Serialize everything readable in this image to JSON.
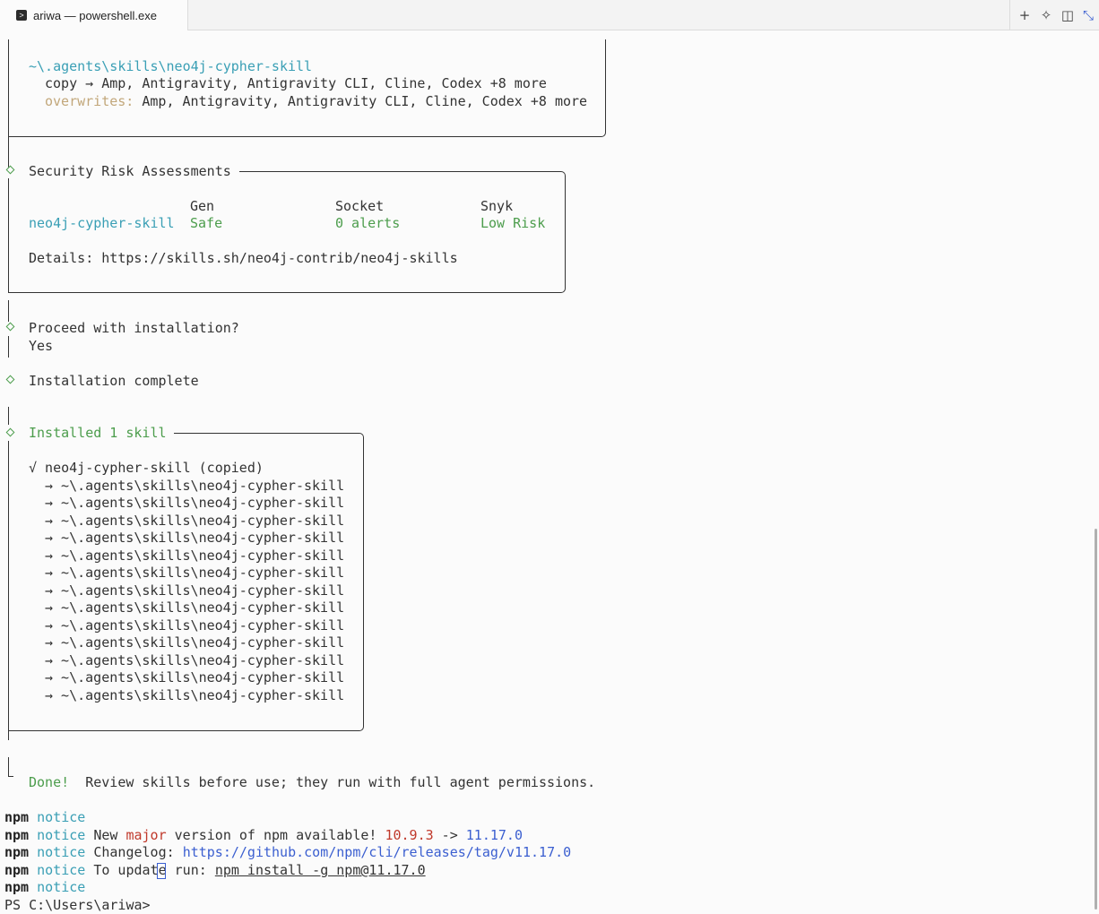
{
  "window": {
    "tab_title": "ariwa — powershell.exe",
    "tab_icon": "powershell-icon",
    "buttons": {
      "new_tab": "+",
      "magic": "✧",
      "split": "◫",
      "collapse": "⤡"
    }
  },
  "terminal": {
    "paths": {
      "path": "~\\.agents\\skills\\neo4j-cypher-skill",
      "copy_prefix": "copy → ",
      "copy_targets": "Amp, Antigravity, Antigravity CLI, Cline, Codex +8 more",
      "overwrites_label": "overwrites:",
      "overwrites_targets": " Amp, Antigravity, Antigravity CLI, Cline, Codex +8 more"
    },
    "security": {
      "title": "Security Risk Assessments",
      "headers": [
        "Gen",
        "Socket",
        "Snyk"
      ],
      "skill": "neo4j-cypher-skill",
      "gen": "Safe",
      "socket": "0 alerts",
      "snyk": "Low Risk",
      "details": "Details: https://skills.sh/neo4j-contrib/neo4j-skills"
    },
    "proceed": {
      "question": "Proceed with installation?",
      "answer": "Yes"
    },
    "complete": "Installation complete",
    "installed": {
      "title": "Installed 1 skill",
      "skill_line": "√ neo4j-cypher-skill (copied)",
      "targets": [
        "→ ~\\.agents\\skills\\neo4j-cypher-skill",
        "→ ~\\.agents\\skills\\neo4j-cypher-skill",
        "→ ~\\.agents\\skills\\neo4j-cypher-skill",
        "→ ~\\.agents\\skills\\neo4j-cypher-skill",
        "→ ~\\.agents\\skills\\neo4j-cypher-skill",
        "→ ~\\.agents\\skills\\neo4j-cypher-skill",
        "→ ~\\.agents\\skills\\neo4j-cypher-skill",
        "→ ~\\.agents\\skills\\neo4j-cypher-skill",
        "→ ~\\.agents\\skills\\neo4j-cypher-skill",
        "→ ~\\.agents\\skills\\neo4j-cypher-skill",
        "→ ~\\.agents\\skills\\neo4j-cypher-skill",
        "→ ~\\.agents\\skills\\neo4j-cypher-skill",
        "→ ~\\.agents\\skills\\neo4j-cypher-skill"
      ]
    },
    "done": {
      "label": "Done!",
      "message": "  Review skills before use; they run with full agent permissions."
    },
    "npm": {
      "prefix": "npm",
      "notice": "notice",
      "new_text": " New ",
      "major": "major",
      "version_text": " version of npm available! ",
      "old_version": "10.9.3",
      "arrow": " -> ",
      "new_version": "11.17.0",
      "changelog_label": " Changelog: ",
      "changelog_url": "https://github.com/npm/cli/releases/tag/v11.17.0",
      "update_label": " To update run: ",
      "update_cmd": "npm install -g npm@11.17.0"
    },
    "prompt": "PS C:\\Users\\ariwa> "
  }
}
